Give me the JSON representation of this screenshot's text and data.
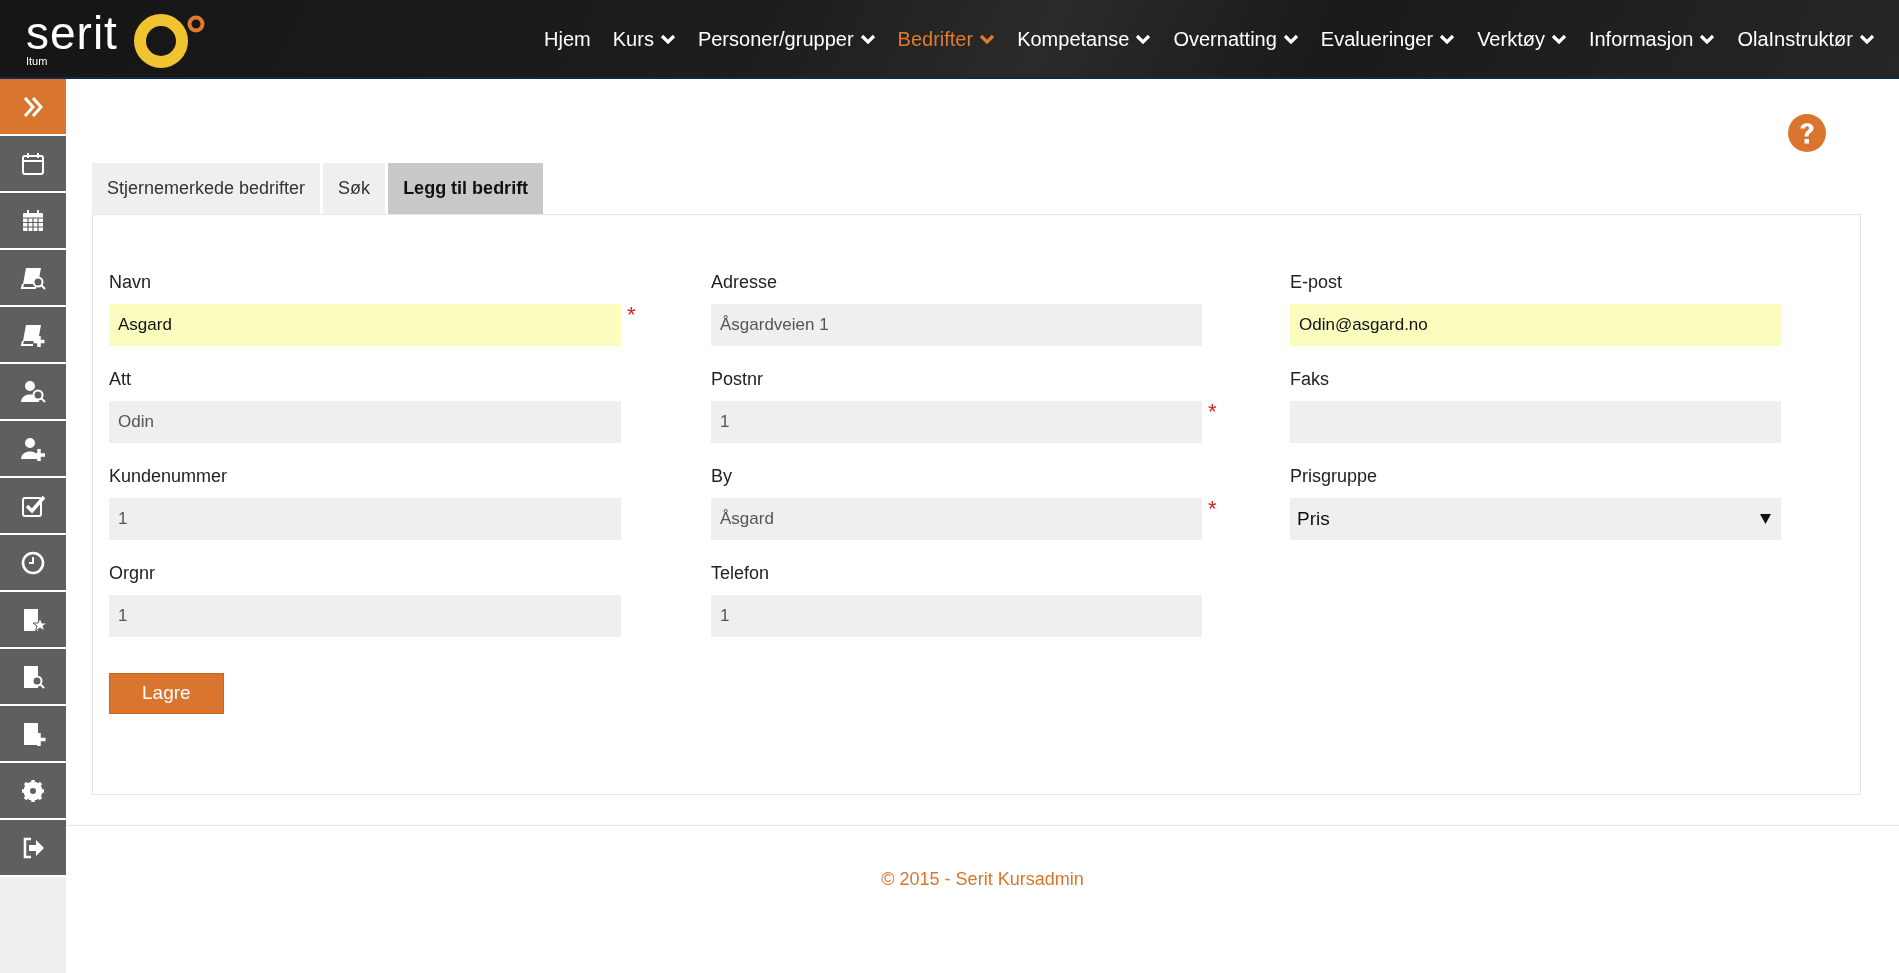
{
  "logo": {
    "name": "serit",
    "subtitle": "Itum"
  },
  "nav": [
    {
      "label": "Hjem",
      "dropdown": false,
      "selected": false
    },
    {
      "label": "Kurs",
      "dropdown": true,
      "selected": false
    },
    {
      "label": "Personer/grupper",
      "dropdown": true,
      "selected": false
    },
    {
      "label": "Bedrifter",
      "dropdown": true,
      "selected": true
    },
    {
      "label": "Kompetanse",
      "dropdown": true,
      "selected": false
    },
    {
      "label": "Overnatting",
      "dropdown": true,
      "selected": false
    },
    {
      "label": "Evalueringer",
      "dropdown": true,
      "selected": false
    },
    {
      "label": "Verktøy",
      "dropdown": true,
      "selected": false
    },
    {
      "label": "Informasjon",
      "dropdown": true,
      "selected": false
    },
    {
      "label": "OlaInstruktør",
      "dropdown": true,
      "selected": false
    }
  ],
  "sidebar": {
    "items": [
      {
        "selected": true
      },
      {
        "selected": false
      },
      {
        "selected": false
      },
      {
        "selected": false
      },
      {
        "selected": false
      },
      {
        "selected": false
      },
      {
        "selected": false
      },
      {
        "selected": false
      },
      {
        "selected": false
      },
      {
        "selected": false
      },
      {
        "selected": false
      },
      {
        "selected": false
      },
      {
        "selected": false
      },
      {
        "selected": false
      }
    ]
  },
  "tabs": [
    {
      "label": "Stjernemerkede bedrifter",
      "selected": false
    },
    {
      "label": "Søk",
      "selected": false
    },
    {
      "label": "Legg til bedrift",
      "selected": true
    }
  ],
  "form": {
    "columns": [
      [
        {
          "kind": "text",
          "label": "Navn",
          "value": "Asgard",
          "highlighted": true,
          "required_mark": "*"
        },
        {
          "kind": "text",
          "label": "Att",
          "value": "Odin",
          "highlighted": false
        },
        {
          "kind": "text",
          "label": "Kundenummer",
          "value": "1",
          "highlighted": false
        },
        {
          "kind": "text",
          "label": "Orgnr",
          "value": "1",
          "highlighted": false
        }
      ],
      [
        {
          "kind": "text",
          "label": "Adresse",
          "value": "Åsgardveien 1",
          "highlighted": false
        },
        {
          "kind": "text",
          "label": "Postnr",
          "value": "1",
          "highlighted": false,
          "required_mark": "*"
        },
        {
          "kind": "text",
          "label": "By",
          "value": "Åsgard",
          "highlighted": false,
          "required_mark": "*"
        },
        {
          "kind": "text",
          "label": "Telefon",
          "value": "1",
          "highlighted": false
        }
      ],
      [
        {
          "kind": "text",
          "label": "E-post",
          "value": "Odin@asgard.no",
          "highlighted": true
        },
        {
          "kind": "text",
          "label": "Faks",
          "highlighted": false
        },
        {
          "kind": "select",
          "label": "Prisgruppe",
          "value": "Pris",
          "highlighted": false
        }
      ]
    ],
    "save_button": "Lagre"
  },
  "footer": "© 2015 - Serit Kursadmin"
}
